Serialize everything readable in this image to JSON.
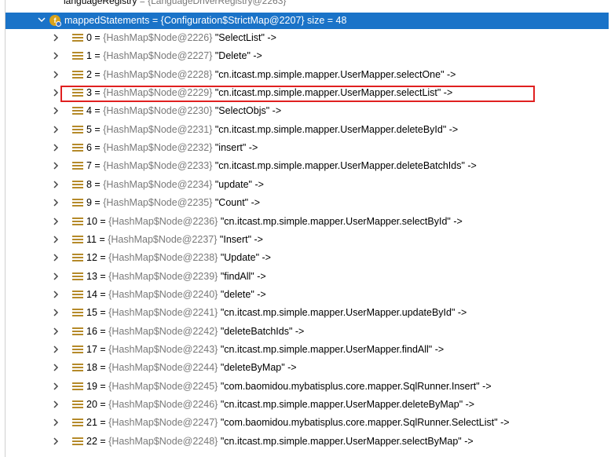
{
  "top_cut": {
    "left": "languageRegistry",
    "right": "= {LanguageDriverRegistry@2263}"
  },
  "header": {
    "label": "mappedStatements = {Configuration$StrictMap@2207}  size = 48",
    "badge": "f"
  },
  "nodes": [
    {
      "index": "0",
      "ref": "{HashMap$Node@2226}",
      "value": "\"SelectList\" ->"
    },
    {
      "index": "1",
      "ref": "{HashMap$Node@2227}",
      "value": "\"Delete\" ->"
    },
    {
      "index": "2",
      "ref": "{HashMap$Node@2228}",
      "value": "\"cn.itcast.mp.simple.mapper.UserMapper.selectOne\" ->"
    },
    {
      "index": "3",
      "ref": "{HashMap$Node@2229}",
      "value": "\"cn.itcast.mp.simple.mapper.UserMapper.selectList\" ->"
    },
    {
      "index": "4",
      "ref": "{HashMap$Node@2230}",
      "value": "\"SelectObjs\" ->"
    },
    {
      "index": "5",
      "ref": "{HashMap$Node@2231}",
      "value": "\"cn.itcast.mp.simple.mapper.UserMapper.deleteById\" ->"
    },
    {
      "index": "6",
      "ref": "{HashMap$Node@2232}",
      "value": "\"insert\" ->"
    },
    {
      "index": "7",
      "ref": "{HashMap$Node@2233}",
      "value": "\"cn.itcast.mp.simple.mapper.UserMapper.deleteBatchIds\" ->"
    },
    {
      "index": "8",
      "ref": "{HashMap$Node@2234}",
      "value": "\"update\" ->"
    },
    {
      "index": "9",
      "ref": "{HashMap$Node@2235}",
      "value": "\"Count\" ->"
    },
    {
      "index": "10",
      "ref": "{HashMap$Node@2236}",
      "value": "\"cn.itcast.mp.simple.mapper.UserMapper.selectById\" ->"
    },
    {
      "index": "11",
      "ref": "{HashMap$Node@2237}",
      "value": "\"Insert\" ->"
    },
    {
      "index": "12",
      "ref": "{HashMap$Node@2238}",
      "value": "\"Update\" ->"
    },
    {
      "index": "13",
      "ref": "{HashMap$Node@2239}",
      "value": "\"findAll\" ->"
    },
    {
      "index": "14",
      "ref": "{HashMap$Node@2240}",
      "value": "\"delete\" ->"
    },
    {
      "index": "15",
      "ref": "{HashMap$Node@2241}",
      "value": "\"cn.itcast.mp.simple.mapper.UserMapper.updateById\" ->"
    },
    {
      "index": "16",
      "ref": "{HashMap$Node@2242}",
      "value": "\"deleteBatchIds\" ->"
    },
    {
      "index": "17",
      "ref": "{HashMap$Node@2243}",
      "value": "\"cn.itcast.mp.simple.mapper.UserMapper.findAll\" ->"
    },
    {
      "index": "18",
      "ref": "{HashMap$Node@2244}",
      "value": "\"deleteByMap\" ->"
    },
    {
      "index": "19",
      "ref": "{HashMap$Node@2245}",
      "value": "\"com.baomidou.mybatisplus.core.mapper.SqlRunner.Insert\" ->"
    },
    {
      "index": "20",
      "ref": "{HashMap$Node@2246}",
      "value": "\"cn.itcast.mp.simple.mapper.UserMapper.deleteByMap\" ->"
    },
    {
      "index": "21",
      "ref": "{HashMap$Node@2247}",
      "value": "\"com.baomidou.mybatisplus.core.mapper.SqlRunner.SelectList\" ->"
    },
    {
      "index": "22",
      "ref": "{HashMap$Node@2248}",
      "value": "\"cn.itcast.mp.simple.mapper.UserMapper.selectByMap\" ->"
    }
  ],
  "highlighted_index": "3",
  "colors": {
    "selection": "#1a73c8",
    "highlight_border": "#e02020",
    "ref_text": "#7a7a7a",
    "field_badge": "#d9a21a"
  }
}
